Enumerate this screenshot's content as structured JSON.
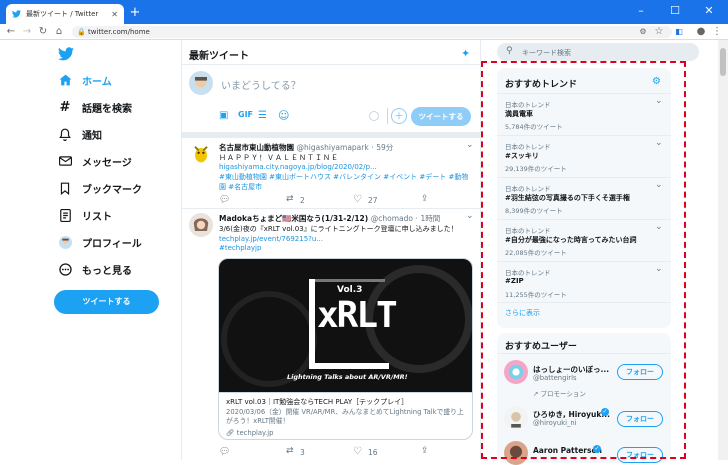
{
  "browser": {
    "tab_title": "最新ツイート / Twitter",
    "url": "twitter.com/home"
  },
  "nav": {
    "home": "ホーム",
    "explore": "話題を検索",
    "notifications": "通知",
    "messages": "メッセージ",
    "bookmarks": "ブックマーク",
    "lists": "リスト",
    "profile": "プロフィール",
    "more": "もっと見る",
    "tweet_button": "ツイートする"
  },
  "timeline": {
    "title": "最新ツイート",
    "compose_placeholder": "いまどうしてる？",
    "compose_button": "ツイートする",
    "tweets": [
      {
        "name": "名古屋市東山動植物園",
        "handle": "@higashiyamapark",
        "time": "59分",
        "line1": "ＨＡＰＰＹ！ＶＡＬＥＮＴＩＮＥ",
        "link": "higashiyama.city.nagoya.jp/blog/2020/02/p...",
        "tags": "#東山動植物園 #東山ボートハウス #バレンタイン #イベント #デート #動物園 #名古屋市",
        "replies": "",
        "retweets": "2",
        "likes": "27"
      },
      {
        "name": "Madokaちょまど🇺🇸米国なう(1/31-2/12)",
        "handle": "@chomado",
        "time": "1時間",
        "text": "3/6(金)夜の『xRLT vol.03』にライトニングトーク登壇に申し込みました！",
        "link": "techplay.jp/event/769215?u...",
        "tag": "#techplayjp",
        "image_title": "xRLT",
        "image_vol": "Vol.3",
        "image_sub": "Lightning Talks about AR/VR/MR!",
        "card_title": "xRLT vol.03｜IT勉強会ならTECH PLAY［テックプレイ］",
        "card_desc": "2020/03/06（金）開催 VR/AR/MR、みんなまとめてLightning Talkで盛り上がろう！xRLT開催！",
        "card_domain": "techplay.jp",
        "retweets": "3",
        "likes": "16"
      }
    ]
  },
  "sidebar": {
    "search_placeholder": "キーワード検索",
    "trends_title": "おすすめトレンド",
    "trends": [
      {
        "category": "日本のトレンド",
        "name": "満員電車",
        "count": "5,784件のツイート"
      },
      {
        "category": "日本のトレンド",
        "name": "#スッキリ",
        "count": "29,139件のツイート"
      },
      {
        "category": "日本のトレンド",
        "name": "#羽生結弦の写真撮るの下手くそ選手権",
        "count": "8,399件のツイート"
      },
      {
        "category": "日本のトレンド",
        "name": "#自分が最強になった時言ってみたい台詞",
        "count": "22,085件のツイート"
      },
      {
        "category": "日本のトレンド",
        "name": "#ZIP",
        "count": "11,255件のツイート"
      }
    ],
    "show_more": "さらに表示",
    "users_title": "おすすめユーザー",
    "users": [
      {
        "name": "はっしょーのいぼっ...",
        "handle": "@battengirls",
        "promo": "プロモーション",
        "follow": "フォロー"
      },
      {
        "name": "ひろゆき, Hiroyuk...",
        "handle": "@hiroyuki_ni",
        "follow": "フォロー"
      },
      {
        "name": "Aaron Patterson",
        "handle": "",
        "follow": "フォロー"
      }
    ]
  },
  "colors": {
    "accent": "#1da1f2",
    "highlight_border": "#e0001b",
    "chrome": "#1a73e8"
  }
}
